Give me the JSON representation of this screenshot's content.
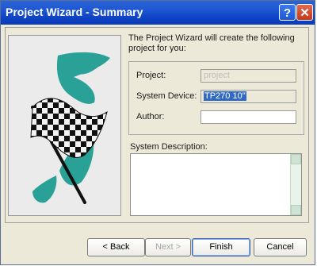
{
  "window": {
    "title": "Project Wizard - Summary",
    "help_glyph": "?",
    "close_glyph": "✕"
  },
  "summary": {
    "intro_text": "The Project Wizard will create the following project for you:"
  },
  "fields": {
    "project_label": "Project:",
    "project_value": "project",
    "device_label": "System Device:",
    "device_value": "TP270 10\"",
    "author_label": "Author:",
    "author_value": ""
  },
  "description": {
    "label": "System Description:",
    "value": ""
  },
  "buttons": {
    "back": "< Back",
    "next": "Next >",
    "finish": "Finish",
    "cancel": "Cancel"
  },
  "colors": {
    "title_bar": "#1d56d2",
    "selection": "#316ac5",
    "teal_art": "#2aa196"
  }
}
